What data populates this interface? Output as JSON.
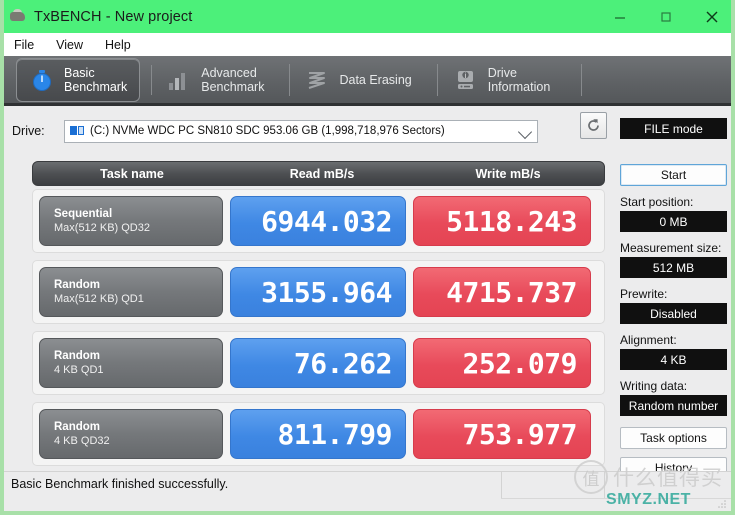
{
  "window": {
    "title": "TxBENCH - New project",
    "title_icon": "app-icon",
    "minimize": "–",
    "maximize": "□",
    "close": "✕",
    "accent_green": "#4cf07a",
    "read_color": "#3f88e4",
    "write_color": "#e84a5a"
  },
  "menu": {
    "items": [
      {
        "label": "File"
      },
      {
        "label": "View"
      },
      {
        "label": "Help"
      }
    ]
  },
  "tabs": [
    {
      "line1": "Basic",
      "line2": "Benchmark",
      "icon": "stopwatch-icon",
      "active": true
    },
    {
      "line1": "Advanced",
      "line2": "Benchmark",
      "icon": "bar-chart-icon",
      "active": false
    },
    {
      "line1": "Data Erasing",
      "line2": "",
      "icon": "shredder-icon",
      "active": false
    },
    {
      "line1": "Drive",
      "line2": "Information",
      "icon": "drive-info-icon",
      "active": false
    }
  ],
  "drive": {
    "label": "Drive:",
    "selected": "(C:) NVMe WDC PC SN810 SDC  953.06 GB (1,998,718,976 Sectors)",
    "icon": "disk-icon",
    "refresh_icon": "refresh-icon",
    "dropdown_icon": "chevron-down-icon"
  },
  "table": {
    "headers": [
      "Task name",
      "Read mB/s",
      "Write mB/s"
    ],
    "rows": [
      {
        "task_line1": "Sequential",
        "task_line2": "Max(512 KB) QD32",
        "read": "6944.032",
        "write": "5118.243"
      },
      {
        "task_line1": "Random",
        "task_line2": "Max(512 KB) QD1",
        "read": "3155.964",
        "write": "4715.737"
      },
      {
        "task_line1": "Random",
        "task_line2": "4 KB QD1",
        "read": "76.262",
        "write": "252.079"
      },
      {
        "task_line1": "Random",
        "task_line2": "4 KB QD32",
        "read": "811.799",
        "write": "753.977"
      }
    ]
  },
  "panel": {
    "mode": "FILE mode",
    "start_button": "Start",
    "start_position_label": "Start position:",
    "start_position_value": "0 MB",
    "measurement_size_label": "Measurement size:",
    "measurement_size_value": "512 MB",
    "prewrite_label": "Prewrite:",
    "prewrite_value": "Disabled",
    "alignment_label": "Alignment:",
    "alignment_value": "4 KB",
    "writing_data_label": "Writing data:",
    "writing_data_value": "Random number",
    "task_options_button": "Task options",
    "history_button": "History"
  },
  "status": {
    "message": "Basic Benchmark finished successfully."
  },
  "watermark": {
    "badge": "值",
    "cn_text": "什么值得买",
    "site": "SMYZ.NET"
  }
}
